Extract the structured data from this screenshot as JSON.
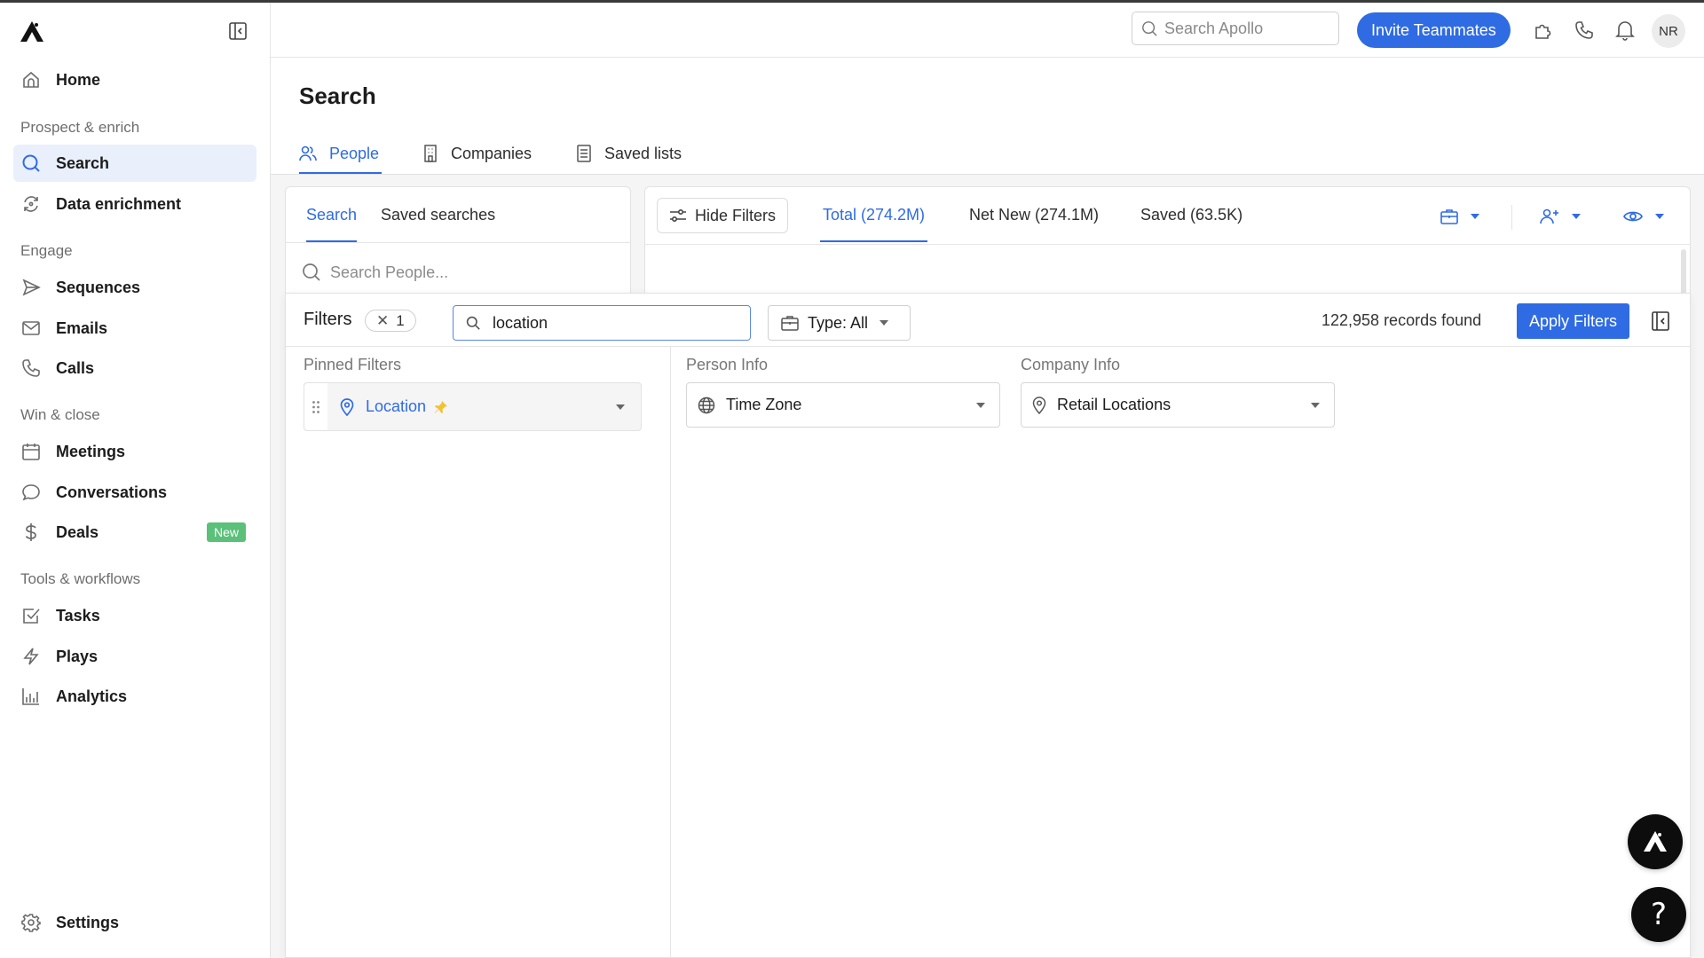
{
  "sidebar": {
    "items": [
      {
        "label": "Home",
        "icon": "home-icon"
      },
      {
        "label": "Search",
        "icon": "search-icon",
        "active": true
      },
      {
        "label": "Data enrichment",
        "icon": "refresh-icon"
      },
      {
        "label": "Sequences",
        "icon": "send-icon"
      },
      {
        "label": "Emails",
        "icon": "mail-icon"
      },
      {
        "label": "Calls",
        "icon": "phone-icon"
      },
      {
        "label": "Meetings",
        "icon": "calendar-icon"
      },
      {
        "label": "Conversations",
        "icon": "chat-bubble-icon"
      },
      {
        "label": "Deals",
        "icon": "dollar-icon",
        "badge": "New"
      },
      {
        "label": "Tasks",
        "icon": "checkbox-icon"
      },
      {
        "label": "Plays",
        "icon": "lightning-icon"
      },
      {
        "label": "Analytics",
        "icon": "bar-chart-icon"
      },
      {
        "label": "Settings",
        "icon": "gear-icon"
      }
    ],
    "sections": [
      "Prospect & enrich",
      "Engage",
      "Win & close",
      "Tools & workflows"
    ],
    "badge_color": "#5bc079"
  },
  "topbar": {
    "search_placeholder": "Search Apollo",
    "invite_label": "Invite Teammates",
    "avatar_initials": "NR",
    "accent": "#2f6be3"
  },
  "page": {
    "title": "Search",
    "tabs": [
      {
        "label": "People",
        "active": true
      },
      {
        "label": "Companies"
      },
      {
        "label": "Saved lists"
      }
    ]
  },
  "left_card": {
    "tabs": [
      {
        "label": "Search",
        "active": true
      },
      {
        "label": "Saved searches"
      }
    ],
    "search_placeholder": "Search People..."
  },
  "right_card": {
    "hide_filters_label": "Hide Filters",
    "count_tabs": [
      {
        "label": "Total (274.2M)",
        "active": true
      },
      {
        "label": "Net New (274.1M)"
      },
      {
        "label": "Saved (63.5K)"
      }
    ]
  },
  "filters": {
    "title": "Filters",
    "active_count": "1",
    "search_value": "location",
    "type_label": "Type: All",
    "records_found": "122,958 records found",
    "apply_label": "Apply Filters",
    "pinned": {
      "heading": "Pinned Filters",
      "items": [
        {
          "label": "Location"
        }
      ]
    },
    "groups": [
      {
        "heading": "Person Info",
        "items": [
          {
            "label": "Time Zone",
            "icon": "globe-icon"
          }
        ]
      },
      {
        "heading": "Company Info",
        "items": [
          {
            "label": "Retail Locations",
            "icon": "location-pin-icon"
          }
        ]
      }
    ]
  }
}
